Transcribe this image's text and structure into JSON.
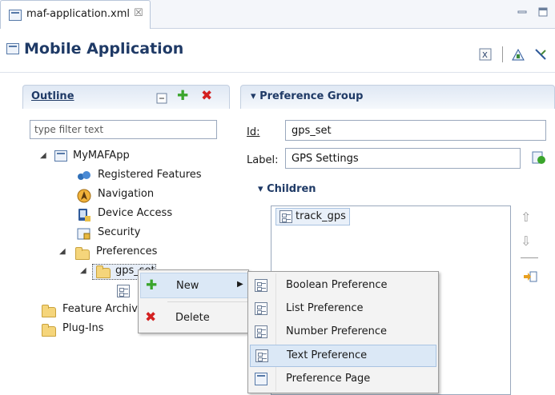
{
  "tab": {
    "title": "maf-application.xml",
    "close_glyph": "☒"
  },
  "header": {
    "title": "Mobile Application"
  },
  "outline": {
    "title": "Outline",
    "filter_placeholder": "type filter text",
    "tree": [
      {
        "label": "MyMAFApp",
        "icon": "application-file-icon"
      },
      {
        "label": "Registered Features",
        "icon": "features-icon"
      },
      {
        "label": "Navigation",
        "icon": "navigation-icon"
      },
      {
        "label": "Device Access",
        "icon": "device-access-icon"
      },
      {
        "label": "Security",
        "icon": "security-icon"
      },
      {
        "label": "Preferences",
        "icon": "folder-open-icon"
      },
      {
        "label": "gps_set",
        "icon": "preference-group-icon"
      },
      {
        "label": "Feature Archives",
        "icon": "folder-icon"
      },
      {
        "label": "Plug-Ins",
        "icon": "folder-icon"
      }
    ]
  },
  "preference_group": {
    "title": "Preference Group",
    "id_label": "Id:",
    "id_value": "gps_set",
    "label_label": "Label:",
    "label_value": "GPS Settings",
    "children_title": "Children",
    "children": [
      "track_gps"
    ]
  },
  "context_menu": {
    "items": [
      {
        "label": "New",
        "icon": "add-icon",
        "has_submenu": true
      },
      {
        "label": "Delete",
        "icon": "delete-icon",
        "has_submenu": false
      }
    ]
  },
  "submenu": {
    "items": [
      {
        "label": "Boolean Preference",
        "icon": "preference-icon"
      },
      {
        "label": "List Preference",
        "icon": "preference-icon"
      },
      {
        "label": "Number Preference",
        "icon": "preference-icon"
      },
      {
        "label": "Text Preference",
        "icon": "preference-icon"
      },
      {
        "label": "Preference Page",
        "icon": "preference-page-icon"
      }
    ],
    "highlighted": "Text Preference"
  }
}
